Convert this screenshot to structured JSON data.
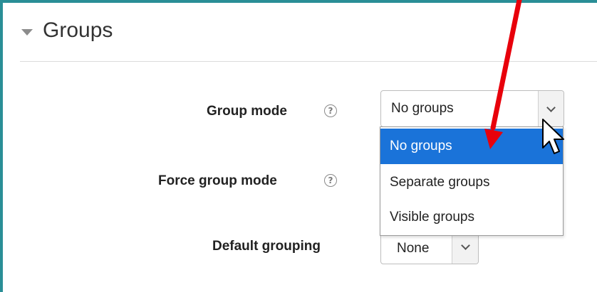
{
  "section": {
    "title": "Groups"
  },
  "fields": {
    "group_mode": {
      "label": "Group mode",
      "value": "No groups"
    },
    "force_group_mode": {
      "label": "Force group mode"
    },
    "default_grouping": {
      "label": "Default grouping",
      "value": "None"
    }
  },
  "dropdown": {
    "options": [
      "No groups",
      "Separate groups",
      "Visible groups"
    ],
    "selected_index": 0
  },
  "colors": {
    "frame_border": "#2a8e96",
    "selected_option_bg": "#1a73d9",
    "annotation_arrow": "#e8000b"
  },
  "icons": [
    "caret-down-icon",
    "help-icon",
    "chevron-down-icon",
    "mouse-pointer-icon",
    "annotation-arrow-icon"
  ]
}
